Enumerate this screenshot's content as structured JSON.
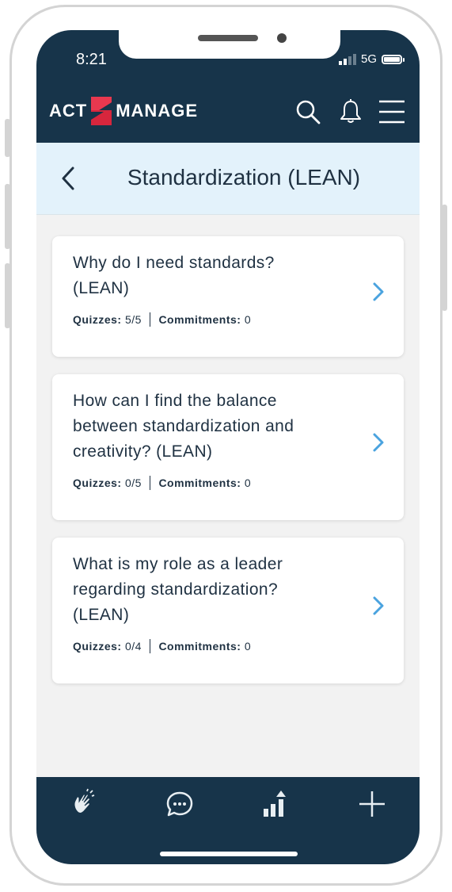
{
  "status_bar": {
    "time": "8:21",
    "network": "5G"
  },
  "header": {
    "logo_left": "ACT",
    "logo_right": "MANAGE"
  },
  "subheader": {
    "title": "Standardization (LEAN)"
  },
  "cards": [
    {
      "title_line1": "Why do I need standards?",
      "title_line2": "(LEAN)",
      "title_line3": "",
      "quizzes_label": "Quizzes:",
      "quizzes_value": "5/5",
      "commitments_label": "Commitments:",
      "commitments_value": "0"
    },
    {
      "title_line1": "How can I find the balance",
      "title_line2": "between standardization and",
      "title_line3": "creativity? (LEAN)",
      "quizzes_label": "Quizzes:",
      "quizzes_value": "0/5",
      "commitments_label": "Commitments:",
      "commitments_value": "0"
    },
    {
      "title_line1": "What is my role as a leader",
      "title_line2": "regarding standardization?",
      "title_line3": "(LEAN)",
      "quizzes_label": "Quizzes:",
      "quizzes_value": "0/4",
      "commitments_label": "Commitments:",
      "commitments_value": "0"
    }
  ],
  "tabbar": {
    "icons": [
      "clapping-hands-icon",
      "chat-bubble-icon",
      "growth-chart-icon",
      "plus-icon"
    ]
  },
  "colors": {
    "primary": "#17344a",
    "accent_red": "#d7263d",
    "chevron": "#4aa3df",
    "subheader_bg": "#e3f2fb"
  }
}
